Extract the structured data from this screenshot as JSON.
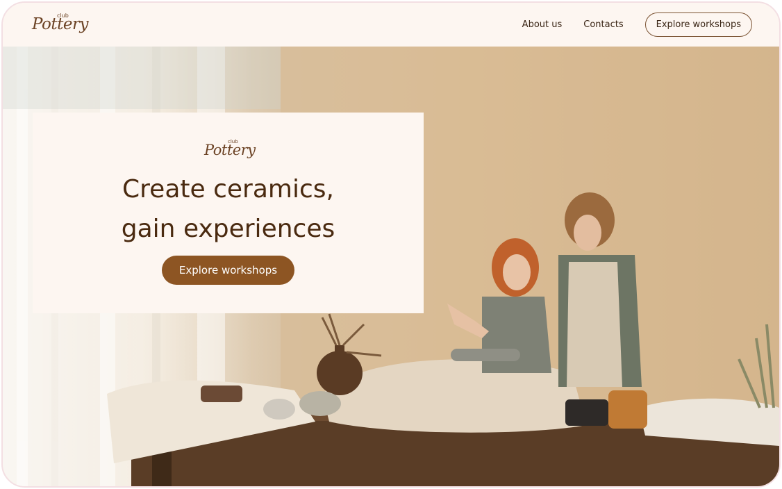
{
  "brand": {
    "logo_small": "club",
    "logo_script": "Pottery"
  },
  "nav": {
    "about": "About us",
    "contacts": "Contacts",
    "cta": "Explore workshops"
  },
  "hero": {
    "card_logo_small": "club",
    "card_logo_script": "Pottery",
    "headline_line1": "Create ceramics,",
    "headline_line2": "gain experiences",
    "cta": "Explore workshops"
  },
  "colors": {
    "accent": "#8d5523",
    "text_dark": "#4a2a10",
    "background": "#fdf6f1"
  }
}
